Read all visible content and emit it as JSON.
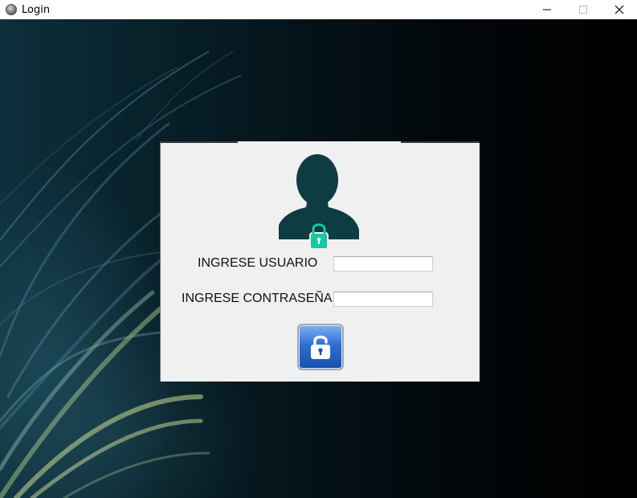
{
  "window": {
    "title": "Login",
    "icons": {
      "app": "app-icon",
      "minimize": "minimize-icon",
      "maximize": "maximize-icon",
      "close": "close-icon"
    }
  },
  "login_form": {
    "avatar_icon": "user-lock-icon",
    "username_label": "INGRESE USUARIO",
    "username_value": "",
    "password_label": "INGRESE CONTRASEÑA",
    "password_value": "",
    "login_button_icon": "unlock-icon"
  },
  "colors": {
    "avatar": "#0d3c42",
    "lock_badge": "#16c99e",
    "button_blue": "#2e6fd4",
    "panel_bg": "#f0f0f0"
  }
}
